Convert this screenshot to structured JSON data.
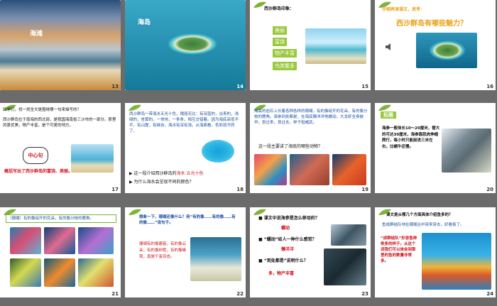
{
  "slides": [
    {
      "num": "13",
      "label": "海滩"
    },
    {
      "num": "14",
      "label": "海岛"
    },
    {
      "num": "15",
      "title": "西沙群岛印象：",
      "tags": [
        "美丽",
        "富饶",
        "物产丰富",
        "鸟类繁多"
      ]
    },
    {
      "num": "16",
      "title": "仔细再读课文，思考：",
      "question": "西沙群岛有哪些魅力？"
    },
    {
      "num": "17",
      "title": "同学们，找一找全文是围绕哪一句来描写的？",
      "body": "西沙群岛位于南海的西北部，是我国海南省三沙市的一部分。那里风景优美，物产丰富，是个可爱的地方。",
      "bubble": "中心句",
      "summary": "概括写出了西沙群岛的富饶、美丽。"
    },
    {
      "num": "18",
      "body": "西沙群岛一带海水五光十色，瑰丽无比：有深蓝的，淡青的，浅绿的，杏黄的。一块块，一条条，相互交错着。因为海底高低不平，有山崖，有峡谷，海水有深有浅，从海面看，色彩就不同了。",
      "q1a": "这一段介绍西沙群岛的",
      "q1b": "海水",
      "q1c": "五光十色",
      "q2": "为什么海水会呈现不同的颜色？"
    },
    {
      "num": "19",
      "body": "海底的岩石上长着各种各样的珊瑚，有的像绽开的花朵，有的像分枝的鹿角。海参到处都是，在海底懒洋洋地蠕动。大龙虾全身披甲，划过来，划过去，样子挺威武。",
      "q": "这一段主要讲了海底的哪些动物？"
    },
    {
      "num": "20",
      "tag": "拓展",
      "body": "海参一般体长10～20厘米，替大的可达30厘米，海参靠肌肉伸缩爬行，每小时只能前进三米左右，比蜗牛还慢。"
    },
    {
      "num": "21",
      "title": "（珊瑚）有的像绽开的花朵，有的像分枝的鹿角。"
    },
    {
      "num": "22",
      "q": "想象一下，珊瑚还像什么？用“有的像……有的像……有的像……”说句子。",
      "ans": "珊瑚有的像蘑菇，有的像云朵，有的像树杈，有的像蜂窝，真是千姿百态。"
    },
    {
      "num": "23",
      "q1": "课文中说海参是怎么移动的？",
      "a1": "蠕动",
      "q2": "“蠕动”给人一种什么感觉？",
      "a2": "懒洋洋",
      "q3": "“到处都是”说明什么？",
      "a3": "多，物产丰富"
    },
    {
      "num": "24",
      "q": "课文是从哪几个方面具体介绍鱼多的？",
      "body": "鱼成群结队地在珊瑚丛中穿来穿去，好看极了。",
      "note": "“成群结队”形容鱼种类多的样子。从这个词我们可以体会到那里的鱼的数量非常多。"
    }
  ],
  "colors": {
    "accent": "#9ac93d",
    "red": "#d0121b",
    "blue": "#1a4fa3",
    "gold": "#e8a317"
  }
}
